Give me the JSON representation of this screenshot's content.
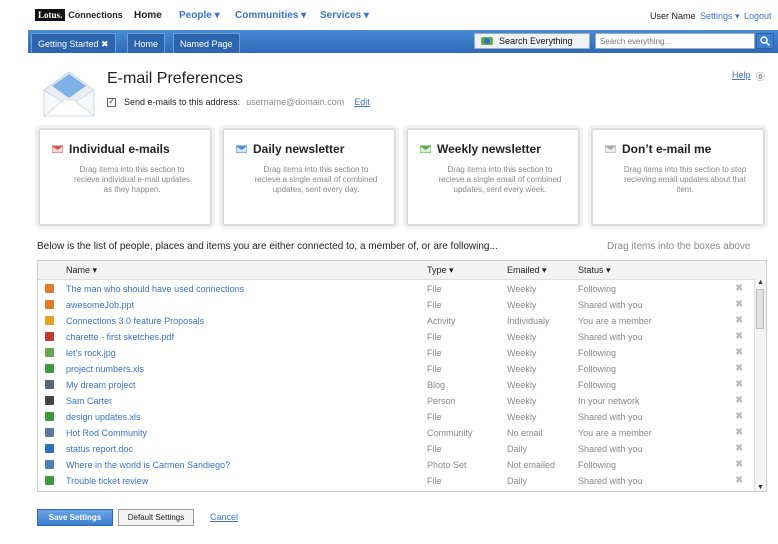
{
  "topbar": {
    "logo_mark": "Lotus.",
    "logo_text": "Connections",
    "nav": [
      "Home",
      "People ▾",
      "Communities ▾",
      "Services ▾"
    ],
    "user_name": "User Name",
    "settings": "Settings ▾",
    "logout": "Logout"
  },
  "tabs": [
    "Getting Started ✖",
    "Home",
    "Named Page"
  ],
  "search": {
    "scope": "Search Everything",
    "scope_arrow": "▾",
    "placeholder": "Search everything...",
    "button_icon": "search-icon"
  },
  "header": {
    "title": "E-mail Preferences",
    "send_label": "Send e-mails to this address:",
    "email": "username@domain.com",
    "edit": "Edit",
    "help": "Help",
    "help_icon": "⓪"
  },
  "boxes": [
    {
      "title": "Individual e-mails",
      "desc": "Drag items into this section to recieve individual e-mail updates as they happen.",
      "icon_color": "#d9534f"
    },
    {
      "title": "Daily newsletter",
      "desc": "Drag items into this section to recieve a single email of combined updates, sent every day.",
      "icon_color": "#4a8ad3"
    },
    {
      "title": "Weekly newsletter",
      "desc": "Drag items into this section to recieve a single email of combined updates, sent every week.",
      "icon_color": "#5aaa4a"
    },
    {
      "title": "Don’t e-mail me",
      "desc": "Drag items into this section to stop recieving email updates about that item.",
      "icon_color": "#aaaaaa"
    }
  ],
  "list": {
    "intro": "Below is the list of people, places and items you are either connected to, a member of, or are following...",
    "drag_hint": "Drag items into the boxes above",
    "columns": {
      "name": "Name ▾",
      "type": "Type ▾",
      "emailed": "Emailed ▾",
      "status": "Status ▾"
    },
    "rows": [
      {
        "name": "The man who should have used connections",
        "type": "File",
        "emailed": "Weekly",
        "status": "Following",
        "icon_color": "#e07b2a"
      },
      {
        "name": "awesomeJob.ppt",
        "type": "File",
        "emailed": "Weekly",
        "status": "Shared with you",
        "icon_color": "#e07b2a"
      },
      {
        "name": "Connections 3.0 feature Proposals",
        "type": "Activity",
        "emailed": "Individualy",
        "status": "You are a member",
        "icon_color": "#e8a020"
      },
      {
        "name": "charette - first sketches.pdf",
        "type": "File",
        "emailed": "Weekly",
        "status": "Shared with you",
        "icon_color": "#c0392b"
      },
      {
        "name": "let's rock.jpg",
        "type": "File",
        "emailed": "Weekly",
        "status": "Following",
        "icon_color": "#6aa84f"
      },
      {
        "name": "project numbers.xls",
        "type": "File",
        "emailed": "Weekly",
        "status": "Following",
        "icon_color": "#3d9a3d"
      },
      {
        "name": "My dream project",
        "type": "Blog",
        "emailed": "Weekly",
        "status": "Following",
        "icon_color": "#556677"
      },
      {
        "name": "Sam Carter",
        "type": "Person",
        "emailed": "Weekly",
        "status": "In your network",
        "icon_color": "#444444"
      },
      {
        "name": "design updates.xls",
        "type": "File",
        "emailed": "Weekly",
        "status": "Shared with you",
        "icon_color": "#3d9a3d"
      },
      {
        "name": "Hot Rod Community",
        "type": "Community",
        "emailed": "No email",
        "status": "You are a member",
        "icon_color": "#5a7a9a"
      },
      {
        "name": "status report.doc",
        "type": "File",
        "emailed": "Daily",
        "status": "Shared with you",
        "icon_color": "#2f6fc0"
      },
      {
        "name": "Where in the world is Carmen Sandiego?",
        "type": "Photo Set",
        "emailed": "Not emailed",
        "status": "Following",
        "icon_color": "#4a7fb5"
      },
      {
        "name": "Trouble ticket review",
        "type": "File",
        "emailed": "Daily",
        "status": "Shared with you",
        "icon_color": "#3d9a3d"
      }
    ],
    "remove_glyph": "✖"
  },
  "footer": {
    "save": "Save Settings",
    "default": "Default Settings",
    "cancel": "Cancel"
  }
}
